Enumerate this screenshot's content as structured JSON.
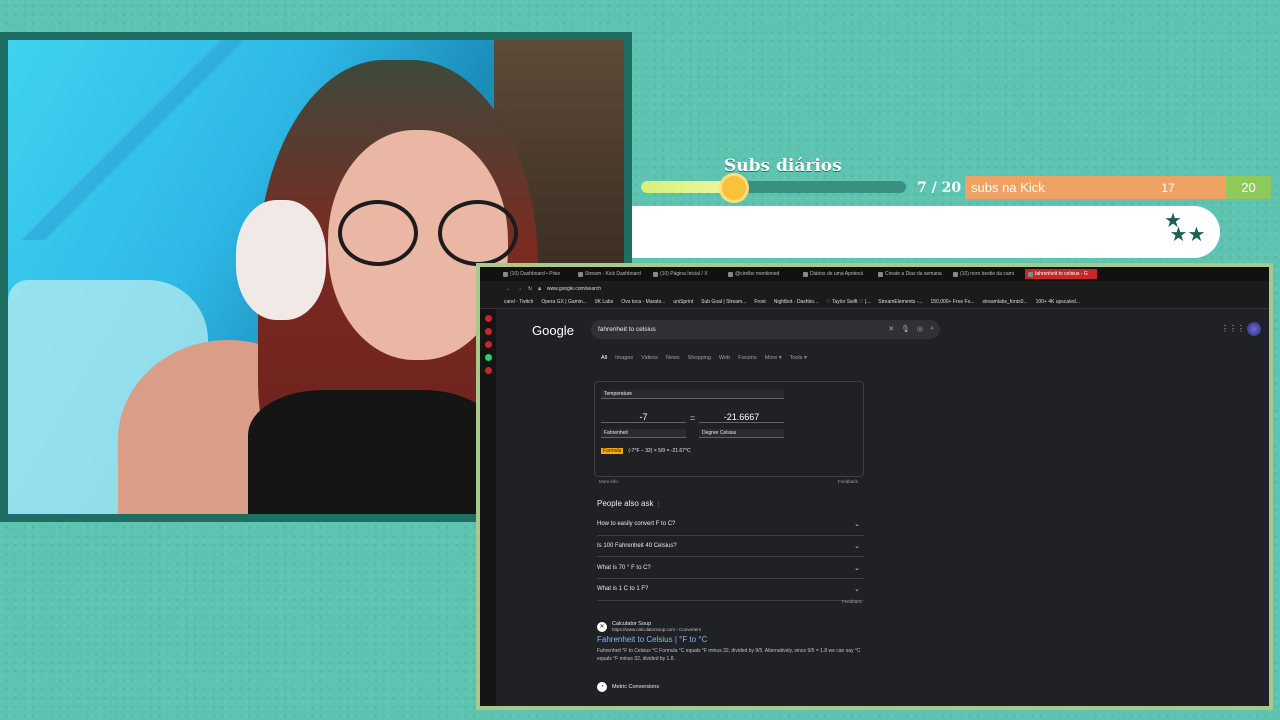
{
  "overlay": {
    "subs_title": "Subs diários",
    "subs_progress": "7 / 20",
    "subs_fraction": 0.35,
    "kick_label": "subs na Kick",
    "kick_value": "17",
    "kick_goal": "20"
  },
  "browser": {
    "tabs": [
      {
        "label": "(10) Dashboard • Pixie",
        "active": false
      },
      {
        "label": "Stream - Kick Dashboard",
        "active": false
      },
      {
        "label": "(10) Página Inicial / X",
        "active": false
      },
      {
        "label": "@cirelbv mentioned",
        "active": false
      },
      {
        "label": "Diários de uma Apotecá",
        "active": false
      },
      {
        "label": "Create a Dias da semana",
        "active": false
      },
      {
        "label": "(10) noro bestie da cami",
        "active": false
      },
      {
        "label": "fahrenheit to celsius - G",
        "active": true
      }
    ],
    "url": "www.google.com/search",
    "bookmarks": [
      "carel - Twitch",
      "Opera GX | Gamin...",
      "9K Labs",
      "Ovo toca - Marato...",
      "uniSprint",
      "Sub Goal | Stream...",
      "Frost",
      "Nightbot - Dashbo...",
      "♡ Taylor Swift ♡ |...",
      "StreamElements -...",
      "150,000+ Free Fo...",
      "streamlabs_fonts0...",
      "100+ 4K upscaled..."
    ]
  },
  "google": {
    "logo": "Google",
    "query": "fahrenheit to celsius",
    "filters": [
      "All",
      "Images",
      "Videos",
      "News",
      "Shopping",
      "Web",
      "Forums",
      "More ▾",
      "Tools ▾"
    ],
    "converter": {
      "unit_type": "Temperature",
      "from_value": "-7",
      "equals": "=",
      "to_value": "-21.6667",
      "from_unit": "Fahrenheit",
      "to_unit": "Degree Celsius",
      "formula_badge": "Formula",
      "formula_text": "(-7°F − 32) × 5/9 = -21.67°C",
      "more_info": "More info",
      "feedback": "Feedback"
    },
    "paa_title": "People also ask",
    "paa_info": "⋮",
    "questions": [
      "How to easily convert F to C?",
      "Is 100 Fahrenheit 40 Celsius?",
      "What is 70 ° F to C?",
      "What is 1 C to 1 F?"
    ],
    "paa_feedback": "Feedback",
    "result1": {
      "site": "Calculator Soup",
      "url": "https://www.calculatorsoup.com › Converters",
      "title": "Fahrenheit to Celsius | °F to °C",
      "snippet": "Fahrenheit °F to Celsius °C Formula °C equals °F minus 32, divided by 9/5. Alternatively, since 9/5 = 1.8 we can say °C equals °F minus 32, divided by 1.8."
    },
    "result2": {
      "site": "Metric Conversions"
    }
  }
}
